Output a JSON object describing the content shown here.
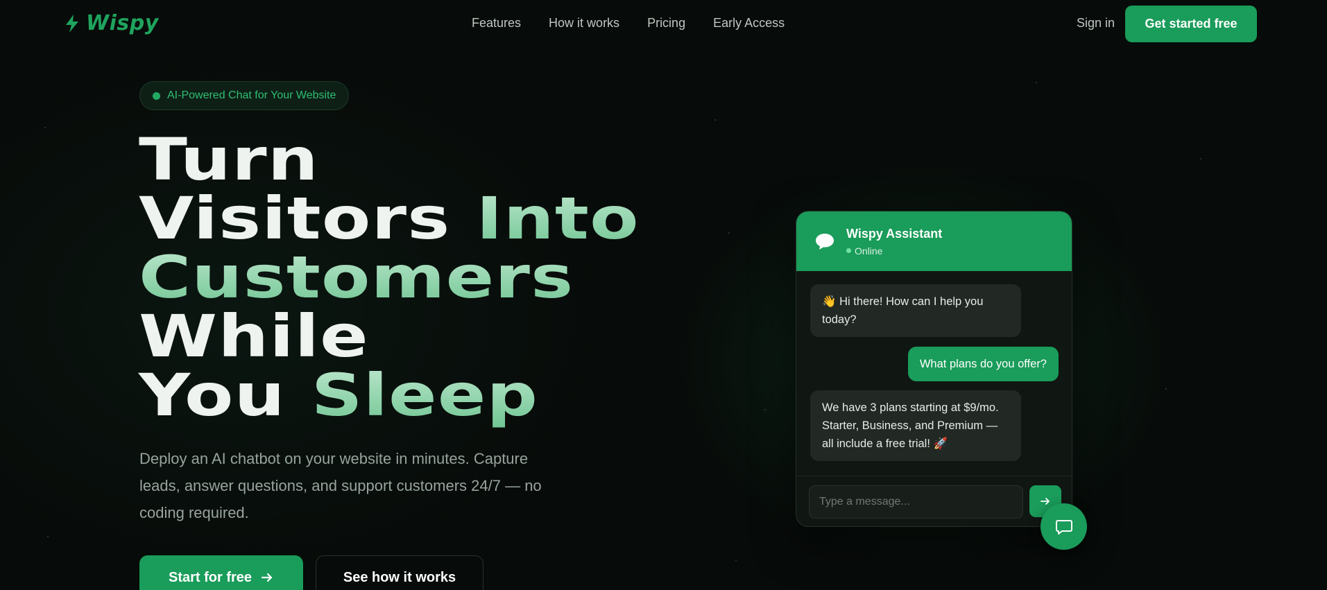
{
  "brand": {
    "name": "Wispy",
    "accent": "#1a9c5a"
  },
  "nav": {
    "links": [
      "Features",
      "How it works",
      "Pricing",
      "Early Access"
    ],
    "signin": "Sign in",
    "cta": "Get started free"
  },
  "hero": {
    "badge": "AI-Powered Chat for Your Website",
    "headline": {
      "line1": "Turn",
      "line2_a": "Visitors",
      "line2_b": "Into",
      "line3": "Customers",
      "line4": "While",
      "line5_a": "You",
      "line5_b": "Sleep"
    },
    "subtext": "Deploy an AI chatbot on your website in minutes. Capture leads, answer questions, and support customers 24/7 — no coding required.",
    "primary_cta": "Start for free",
    "secondary_cta": "See how it works"
  },
  "chat": {
    "title": "Wispy Assistant",
    "status": "Online",
    "messages": [
      {
        "from": "bot",
        "text": "👋 Hi there! How can I help you today?"
      },
      {
        "from": "user",
        "text": "What plans do you offer?"
      },
      {
        "from": "bot",
        "text": "We have 3 plans starting at $9/mo. Starter, Business, and Premium — all include a free trial! 🚀"
      }
    ],
    "input_placeholder": "Type a message..."
  }
}
